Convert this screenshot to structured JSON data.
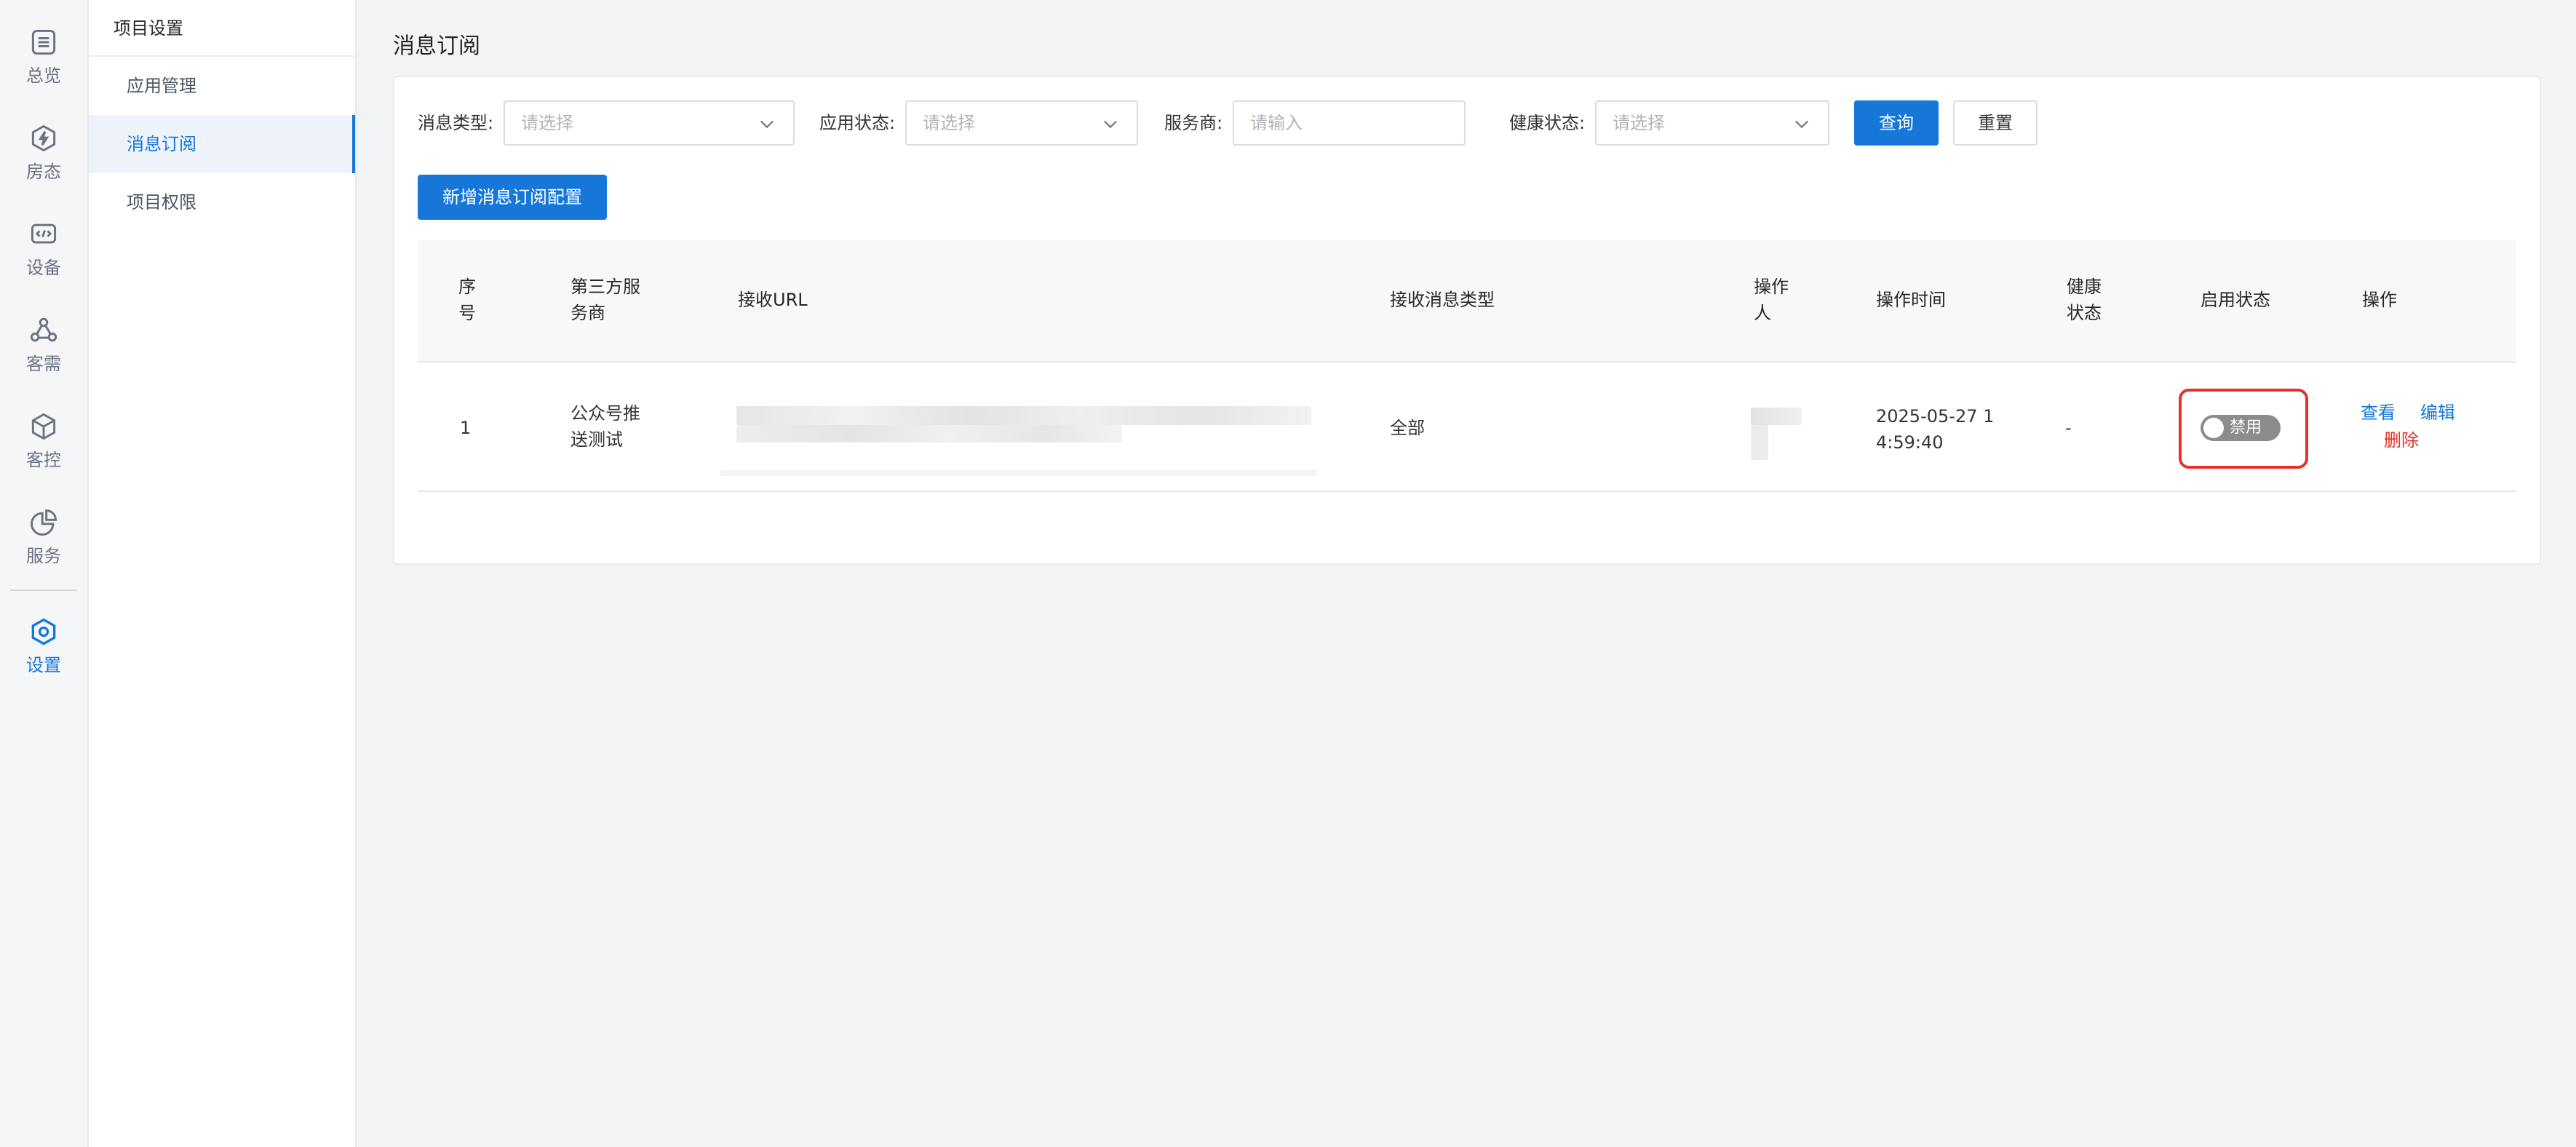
{
  "rail": {
    "items": [
      {
        "label": "总览",
        "icon": "list-icon"
      },
      {
        "label": "房态",
        "icon": "lightning-icon"
      },
      {
        "label": "设备",
        "icon": "code-box-icon"
      },
      {
        "label": "客需",
        "icon": "nodes-icon"
      },
      {
        "label": "客控",
        "icon": "cube-icon"
      },
      {
        "label": "服务",
        "icon": "pie-chart-icon"
      },
      {
        "label": "设置",
        "icon": "gear-hex-icon",
        "active": true
      }
    ]
  },
  "submenu": {
    "title": "项目设置",
    "items": [
      {
        "label": "应用管理"
      },
      {
        "label": "消息订阅",
        "active": true
      },
      {
        "label": "项目权限"
      }
    ]
  },
  "page": {
    "title": "消息订阅"
  },
  "filters": {
    "msg_type_label": "消息类型:",
    "msg_type_placeholder": "请选择",
    "app_status_label": "应用状态:",
    "app_status_placeholder": "请选择",
    "provider_label": "服务商:",
    "provider_placeholder": "请输入",
    "health_label": "健康状态:",
    "health_placeholder": "请选择",
    "query_label": "查询",
    "reset_label": "重置"
  },
  "actions": {
    "add_label": "新增消息订阅配置"
  },
  "table": {
    "headers": {
      "seq_line1": "序",
      "seq_line2": "号",
      "provider_line1": "第三方服",
      "provider_line2": "务商",
      "url": "接收URL",
      "msg_type": "接收消息类型",
      "operator_line1": "操作",
      "operator_line2": "人",
      "op_time": "操作时间",
      "health_line1": "健康",
      "health_line2": "状态",
      "enable": "启用状态",
      "ops": "操作"
    },
    "rows": [
      {
        "seq": "1",
        "provider_line1": "公众号推",
        "provider_line2": "送测试",
        "msg_type": "全部",
        "op_time_line1": "2025-05-27 1",
        "op_time_line2": "4:59:40",
        "health": "-",
        "enable_label": "禁用",
        "view": "查看",
        "edit": "编辑",
        "delete": "删除"
      }
    ]
  },
  "colors": {
    "primary": "#1677d9",
    "danger": "#e5312c",
    "toggle_off": "#8c8c8c"
  }
}
